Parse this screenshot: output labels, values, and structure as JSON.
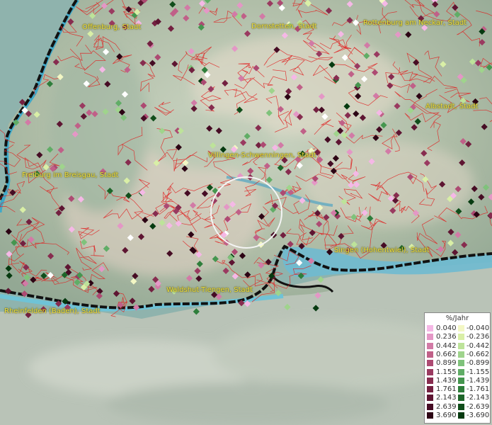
{
  "cities": [
    {
      "name": "Offenburg, Stadt"
    },
    {
      "name": "Dornstetten, Stadt"
    },
    {
      "name": "Rottenburg am Neckar, Stadt"
    },
    {
      "name": "Albstadt, Stadt"
    },
    {
      "name": "Villingen-Schwenningen, Stadt"
    },
    {
      "name": "Freiburg im Breisgau, Stadt"
    },
    {
      "name": "Singen (Hohentwiel), Stadt"
    },
    {
      "name": "Waldshut-Tiengen, Stadt"
    },
    {
      "name": "Rheinfelden (Baden), Stadt"
    }
  ],
  "legend": {
    "title": "%/Jahr",
    "positive": [
      "0.040",
      "0.236",
      "0.442",
      "0.662",
      "0.899",
      "1.155",
      "1.439",
      "1.761",
      "2.143",
      "2.639",
      "3.690"
    ],
    "negative": [
      "-0.040",
      "-0.236",
      "-0.442",
      "-0.662",
      "-0.899",
      "-1.155",
      "-1.439",
      "-1.761",
      "-2.143",
      "-2.639",
      "-3.690"
    ],
    "positive_colors": [
      "#f5b8e6",
      "#e497c6",
      "#d27aa6",
      "#c06088",
      "#ad4a72",
      "#9a3a60",
      "#872c4f",
      "#732040",
      "#5e1532",
      "#460c24",
      "#2c0414"
    ],
    "negative_colors": [
      "#f3f7c4",
      "#d9efa6",
      "#bde39a",
      "#9fd48c",
      "#7fc27b",
      "#60ad66",
      "#45964f",
      "#2e7e3b",
      "#1d6629",
      "#104e1b",
      "#063a10"
    ]
  }
}
